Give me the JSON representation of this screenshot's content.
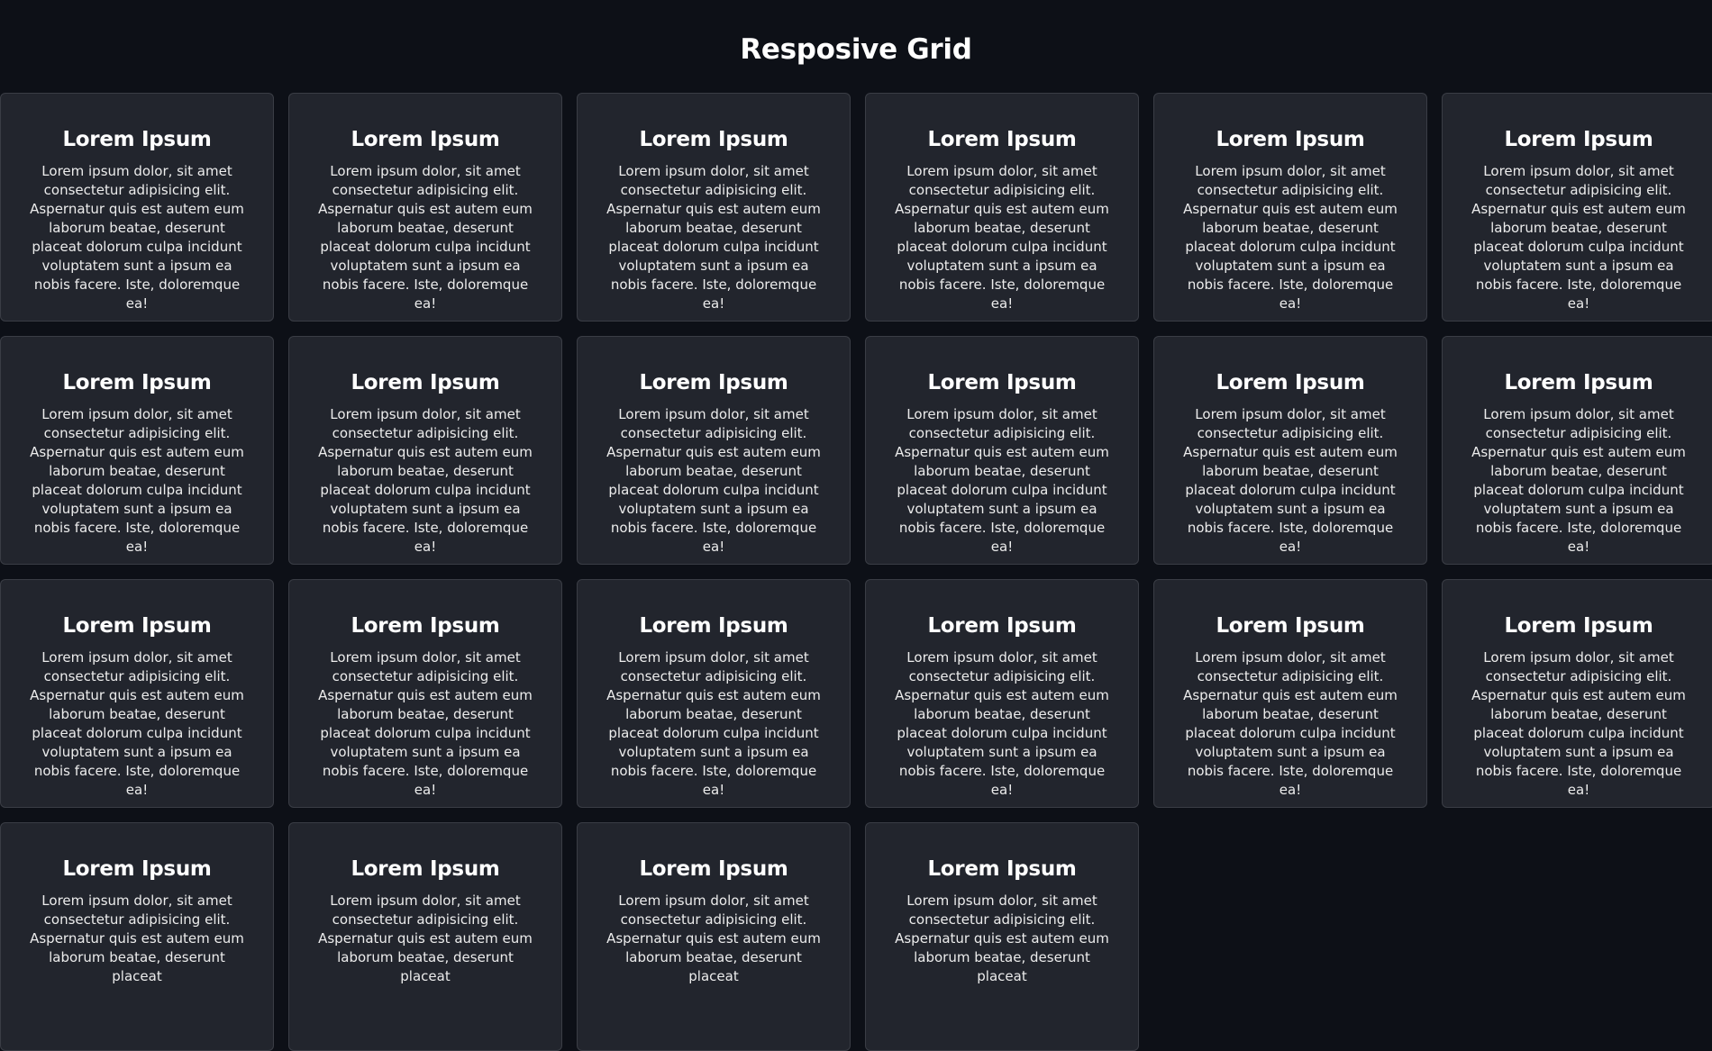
{
  "page": {
    "title": "Resposive Grid"
  },
  "cards": [
    {
      "title": "Lorem Ipsum",
      "text": "Lorem ipsum dolor, sit amet consectetur adipisicing elit. Aspernatur quis est autem eum laborum beatae, deserunt placeat dolorum culpa incidunt voluptatem sunt a ipsum ea nobis facere. Iste, doloremque ea!"
    },
    {
      "title": "Lorem Ipsum",
      "text": "Lorem ipsum dolor, sit amet consectetur adipisicing elit. Aspernatur quis est autem eum laborum beatae, deserunt placeat dolorum culpa incidunt voluptatem sunt a ipsum ea nobis facere. Iste, doloremque ea!"
    },
    {
      "title": "Lorem Ipsum",
      "text": "Lorem ipsum dolor, sit amet consectetur adipisicing elit. Aspernatur quis est autem eum laborum beatae, deserunt placeat dolorum culpa incidunt voluptatem sunt a ipsum ea nobis facere. Iste, doloremque ea!"
    },
    {
      "title": "Lorem Ipsum",
      "text": "Lorem ipsum dolor, sit amet consectetur adipisicing elit. Aspernatur quis est autem eum laborum beatae, deserunt placeat dolorum culpa incidunt voluptatem sunt a ipsum ea nobis facere. Iste, doloremque ea!"
    },
    {
      "title": "Lorem Ipsum",
      "text": "Lorem ipsum dolor, sit amet consectetur adipisicing elit. Aspernatur quis est autem eum laborum beatae, deserunt placeat dolorum culpa incidunt voluptatem sunt a ipsum ea nobis facere. Iste, doloremque ea!"
    },
    {
      "title": "Lorem Ipsum",
      "text": "Lorem ipsum dolor, sit amet consectetur adipisicing elit. Aspernatur quis est autem eum laborum beatae, deserunt placeat dolorum culpa incidunt voluptatem sunt a ipsum ea nobis facere. Iste, doloremque ea!"
    },
    {
      "title": "Lorem Ipsum",
      "text": "Lorem ipsum dolor, sit amet consectetur adipisicing elit. Aspernatur quis est autem eum laborum beatae, deserunt placeat dolorum culpa incidunt voluptatem sunt a ipsum ea nobis facere. Iste, doloremque ea!"
    },
    {
      "title": "Lorem Ipsum",
      "text": "Lorem ipsum dolor, sit amet consectetur adipisicing elit. Aspernatur quis est autem eum laborum beatae, deserunt placeat dolorum culpa incidunt voluptatem sunt a ipsum ea nobis facere. Iste, doloremque ea!"
    },
    {
      "title": "Lorem Ipsum",
      "text": "Lorem ipsum dolor, sit amet consectetur adipisicing elit. Aspernatur quis est autem eum laborum beatae, deserunt placeat dolorum culpa incidunt voluptatem sunt a ipsum ea nobis facere. Iste, doloremque ea!"
    },
    {
      "title": "Lorem Ipsum",
      "text": "Lorem ipsum dolor, sit amet consectetur adipisicing elit. Aspernatur quis est autem eum laborum beatae, deserunt placeat dolorum culpa incidunt voluptatem sunt a ipsum ea nobis facere. Iste, doloremque ea!"
    },
    {
      "title": "Lorem Ipsum",
      "text": "Lorem ipsum dolor, sit amet consectetur adipisicing elit. Aspernatur quis est autem eum laborum beatae, deserunt placeat dolorum culpa incidunt voluptatem sunt a ipsum ea nobis facere. Iste, doloremque ea!"
    },
    {
      "title": "Lorem Ipsum",
      "text": "Lorem ipsum dolor, sit amet consectetur adipisicing elit. Aspernatur quis est autem eum laborum beatae, deserunt placeat dolorum culpa incidunt voluptatem sunt a ipsum ea nobis facere. Iste, doloremque ea!"
    },
    {
      "title": "Lorem Ipsum",
      "text": "Lorem ipsum dolor, sit amet consectetur adipisicing elit. Aspernatur quis est autem eum laborum beatae, deserunt placeat dolorum culpa incidunt voluptatem sunt a ipsum ea nobis facere. Iste, doloremque ea!"
    },
    {
      "title": "Lorem Ipsum",
      "text": "Lorem ipsum dolor, sit amet consectetur adipisicing elit. Aspernatur quis est autem eum laborum beatae, deserunt placeat dolorum culpa incidunt voluptatem sunt a ipsum ea nobis facere. Iste, doloremque ea!"
    },
    {
      "title": "Lorem Ipsum",
      "text": "Lorem ipsum dolor, sit amet consectetur adipisicing elit. Aspernatur quis est autem eum laborum beatae, deserunt placeat dolorum culpa incidunt voluptatem sunt a ipsum ea nobis facere. Iste, doloremque ea!"
    },
    {
      "title": "Lorem Ipsum",
      "text": "Lorem ipsum dolor, sit amet consectetur adipisicing elit. Aspernatur quis est autem eum laborum beatae, deserunt placeat dolorum culpa incidunt voluptatem sunt a ipsum ea nobis facere. Iste, doloremque ea!"
    },
    {
      "title": "Lorem Ipsum",
      "text": "Lorem ipsum dolor, sit amet consectetur adipisicing elit. Aspernatur quis est autem eum laborum beatae, deserunt placeat dolorum culpa incidunt voluptatem sunt a ipsum ea nobis facere. Iste, doloremque ea!"
    },
    {
      "title": "Lorem Ipsum",
      "text": "Lorem ipsum dolor, sit amet consectetur adipisicing elit. Aspernatur quis est autem eum laborum beatae, deserunt placeat dolorum culpa incidunt voluptatem sunt a ipsum ea nobis facere. Iste, doloremque ea!"
    },
    {
      "title": "Lorem Ipsum",
      "text": "Lorem ipsum dolor, sit amet consectetur adipisicing elit. Aspernatur quis est autem eum laborum beatae, deserunt placeat"
    },
    {
      "title": "Lorem Ipsum",
      "text": "Lorem ipsum dolor, sit amet consectetur adipisicing elit. Aspernatur quis est autem eum laborum beatae, deserunt placeat"
    },
    {
      "title": "Lorem Ipsum",
      "text": "Lorem ipsum dolor, sit amet consectetur adipisicing elit. Aspernatur quis est autem eum laborum beatae, deserunt placeat"
    },
    {
      "title": "Lorem Ipsum",
      "text": "Lorem ipsum dolor, sit amet consectetur adipisicing elit. Aspernatur quis est autem eum laborum beatae, deserunt placeat"
    }
  ]
}
